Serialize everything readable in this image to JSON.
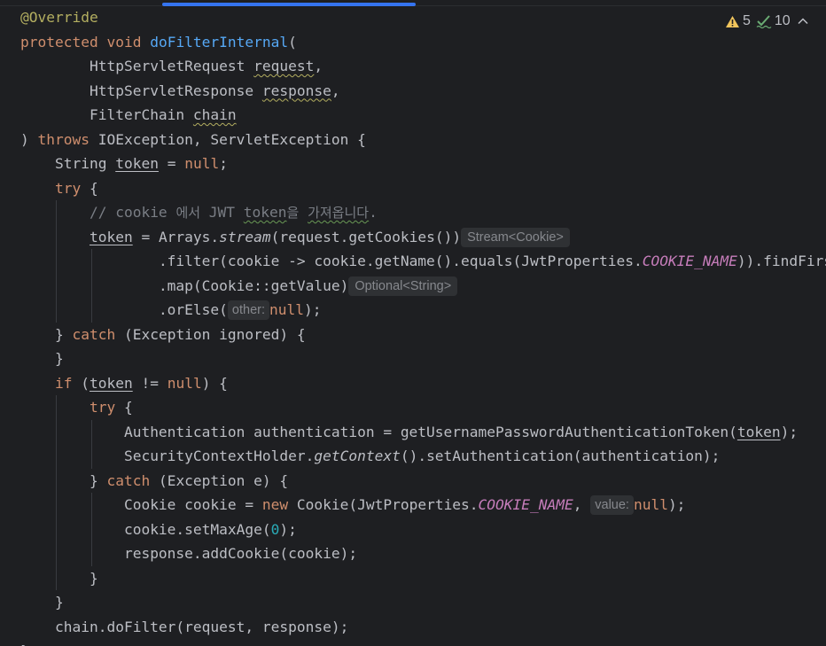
{
  "inspections": {
    "warnings_count": "5",
    "weak_warnings_count": "10"
  },
  "lines": [
    {
      "indent": 0,
      "guides": [],
      "tokens": [
        {
          "t": "@Override",
          "c": "ann"
        }
      ]
    },
    {
      "indent": 0,
      "guides": [],
      "tokens": [
        {
          "t": "protected",
          "c": "kw"
        },
        {
          "t": " "
        },
        {
          "t": "void",
          "c": "kw"
        },
        {
          "t": " "
        },
        {
          "t": "doFilterInternal",
          "c": "fn"
        },
        {
          "t": "("
        }
      ]
    },
    {
      "indent": 8,
      "guides": [],
      "tokens": [
        {
          "t": "HttpServletRequest "
        },
        {
          "t": "request",
          "c": "wavy"
        },
        {
          "t": ","
        }
      ]
    },
    {
      "indent": 8,
      "guides": [],
      "tokens": [
        {
          "t": "HttpServletResponse "
        },
        {
          "t": "response",
          "c": "wavy"
        },
        {
          "t": ","
        }
      ]
    },
    {
      "indent": 8,
      "guides": [],
      "tokens": [
        {
          "t": "FilterChain "
        },
        {
          "t": "chain",
          "c": "wavy"
        }
      ]
    },
    {
      "indent": 0,
      "guides": [],
      "tokens": [
        {
          "t": ") "
        },
        {
          "t": "throws",
          "c": "kw"
        },
        {
          "t": " IOException, ServletException {"
        }
      ]
    },
    {
      "indent": 4,
      "guides": [],
      "tokens": [
        {
          "t": "String "
        },
        {
          "t": "token",
          "c": "ul"
        },
        {
          "t": " = "
        },
        {
          "t": "null",
          "c": "kw"
        },
        {
          "t": ";"
        }
      ]
    },
    {
      "indent": 4,
      "guides": [],
      "tokens": [
        {
          "t": "try",
          "c": "kw"
        },
        {
          "t": " {"
        }
      ]
    },
    {
      "indent": 8,
      "guides": [
        4
      ],
      "tokens": [
        {
          "t": "// cookie ",
          "c": "cmt"
        },
        {
          "t": "에서",
          "c": "cmt cmt-ko"
        },
        {
          "t": " JWT ",
          "c": "cmt"
        },
        {
          "t": "token",
          "c": "cmt wavy-g"
        },
        {
          "t": "을",
          "c": "cmt cmt-ko"
        },
        {
          "t": " ",
          "c": "cmt"
        },
        {
          "t": "가져옵니다",
          "c": "cmt cmt-ko wavy-g"
        },
        {
          "t": ".",
          "c": "cmt"
        }
      ]
    },
    {
      "indent": 8,
      "guides": [
        4
      ],
      "tokens": [
        {
          "t": "token",
          "c": "ul"
        },
        {
          "t": " = Arrays."
        },
        {
          "t": "stream",
          "c": "ital"
        },
        {
          "t": "(request.getCookies())"
        },
        {
          "hint": "Stream<Cookie>"
        }
      ]
    },
    {
      "indent": 16,
      "guides": [
        4,
        8
      ],
      "tokens": [
        {
          "t": ".filter(cookie -> cookie.getName().equals(JwtProperties."
        },
        {
          "t": "COOKIE_NAME",
          "c": "const"
        },
        {
          "t": ")).findFirst()"
        }
      ]
    },
    {
      "indent": 16,
      "guides": [
        4,
        8
      ],
      "tokens": [
        {
          "t": ".map(Cookie::getValue)"
        },
        {
          "hint": "Optional<String>"
        }
      ]
    },
    {
      "indent": 16,
      "guides": [
        4,
        8
      ],
      "tokens": [
        {
          "t": ".orElse("
        },
        {
          "hint": "other:",
          "sm": true
        },
        {
          "t": "null",
          "c": "kw"
        },
        {
          "t": ");"
        }
      ]
    },
    {
      "indent": 4,
      "guides": [],
      "tokens": [
        {
          "t": "} "
        },
        {
          "t": "catch",
          "c": "kw"
        },
        {
          "t": " (Exception ignored) {"
        }
      ]
    },
    {
      "indent": 4,
      "guides": [],
      "tokens": [
        {
          "t": "}"
        }
      ]
    },
    {
      "indent": 4,
      "guides": [],
      "tokens": [
        {
          "t": "if",
          "c": "kw"
        },
        {
          "t": " ("
        },
        {
          "t": "token",
          "c": "ul"
        },
        {
          "t": " != "
        },
        {
          "t": "null",
          "c": "kw"
        },
        {
          "t": ") {"
        }
      ]
    },
    {
      "indent": 8,
      "guides": [
        4
      ],
      "tokens": [
        {
          "t": "try",
          "c": "kw"
        },
        {
          "t": " {"
        }
      ]
    },
    {
      "indent": 12,
      "guides": [
        4,
        8
      ],
      "tokens": [
        {
          "t": "Authentication authentication = getUsernamePasswordAuthenticationToken("
        },
        {
          "t": "token",
          "c": "ul"
        },
        {
          "t": ");"
        }
      ]
    },
    {
      "indent": 12,
      "guides": [
        4,
        8
      ],
      "tokens": [
        {
          "t": "SecurityContextHolder."
        },
        {
          "t": "getContext",
          "c": "ital"
        },
        {
          "t": "().setAuthentication(authentication);"
        }
      ]
    },
    {
      "indent": 8,
      "guides": [
        4
      ],
      "tokens": [
        {
          "t": "} "
        },
        {
          "t": "catch",
          "c": "kw"
        },
        {
          "t": " (Exception e) {"
        }
      ]
    },
    {
      "indent": 12,
      "guides": [
        4,
        8
      ],
      "tokens": [
        {
          "t": "Cookie cookie = "
        },
        {
          "t": "new",
          "c": "kw"
        },
        {
          "t": " Cookie(JwtProperties."
        },
        {
          "t": "COOKIE_NAME",
          "c": "const"
        },
        {
          "t": ", "
        },
        {
          "hint": "value:",
          "sm": true
        },
        {
          "t": "null",
          "c": "kw"
        },
        {
          "t": ");"
        }
      ]
    },
    {
      "indent": 12,
      "guides": [
        4,
        8
      ],
      "tokens": [
        {
          "t": "cookie.setMaxAge("
        },
        {
          "t": "0",
          "c": "num"
        },
        {
          "t": ");"
        }
      ]
    },
    {
      "indent": 12,
      "guides": [
        4,
        8
      ],
      "tokens": [
        {
          "t": "response.addCookie(cookie);"
        }
      ]
    },
    {
      "indent": 8,
      "guides": [
        4
      ],
      "tokens": [
        {
          "t": "}"
        }
      ]
    },
    {
      "indent": 4,
      "guides": [],
      "tokens": [
        {
          "t": "}"
        }
      ]
    },
    {
      "indent": 4,
      "guides": [],
      "tokens": [
        {
          "t": "chain.doFilter(request, response);"
        }
      ]
    },
    {
      "indent": 0,
      "guides": [],
      "tokens": [
        {
          "t": "}"
        }
      ]
    }
  ]
}
